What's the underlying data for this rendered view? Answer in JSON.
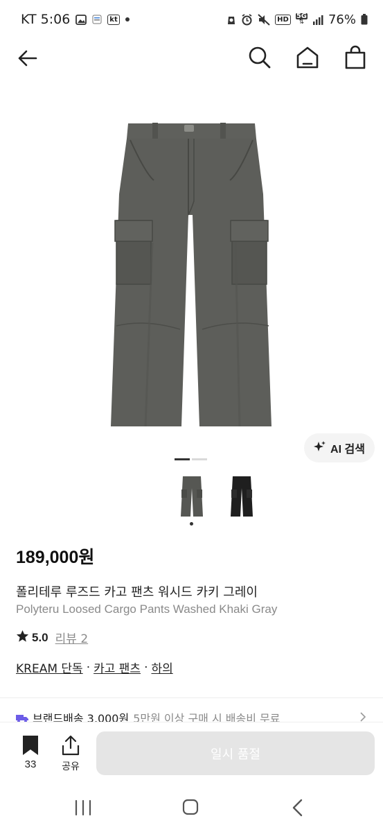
{
  "status_bar": {
    "carrier_time": "KT 5:06",
    "kt_badge": "kt",
    "hd_badge": "HD",
    "network": "5G",
    "battery": "76%"
  },
  "header": {
    "icons": [
      "back-arrow-icon",
      "search-icon",
      "home-icon",
      "shopping-bag-icon"
    ]
  },
  "product": {
    "ai_search_label": "AI 검색",
    "image_count": 2,
    "current_image": 1,
    "thumbnails": [
      {
        "color": "#565753",
        "selected": true
      },
      {
        "color": "#1f1f1f",
        "selected": false
      }
    ],
    "price": "189,000원",
    "name_ko": "폴리테루 루즈드 카고 팬츠 워시드 카키 그레이",
    "name_en": "Polyteru Loosed Cargo Pants Washed Khaki Gray",
    "rating": "5.0",
    "review_label": "리뷰 2",
    "tags": [
      "KREAM 단독",
      "카고 팬츠",
      "하의"
    ],
    "tag_separator": "·"
  },
  "shipping": {
    "main": "브랜드배송 3,000원",
    "sub": "5만원 이상 구매 시 배송비 무료"
  },
  "action_bar": {
    "bookmark_count": "33",
    "share_label": "공유",
    "soldout_label": "일시 품절"
  },
  "colors": {
    "pants_main": "#5d5e5a",
    "pants_shadow": "#4a4b47",
    "soldout_bg": "#e5e5e5",
    "shipping_icon": "#6c5ce7"
  }
}
